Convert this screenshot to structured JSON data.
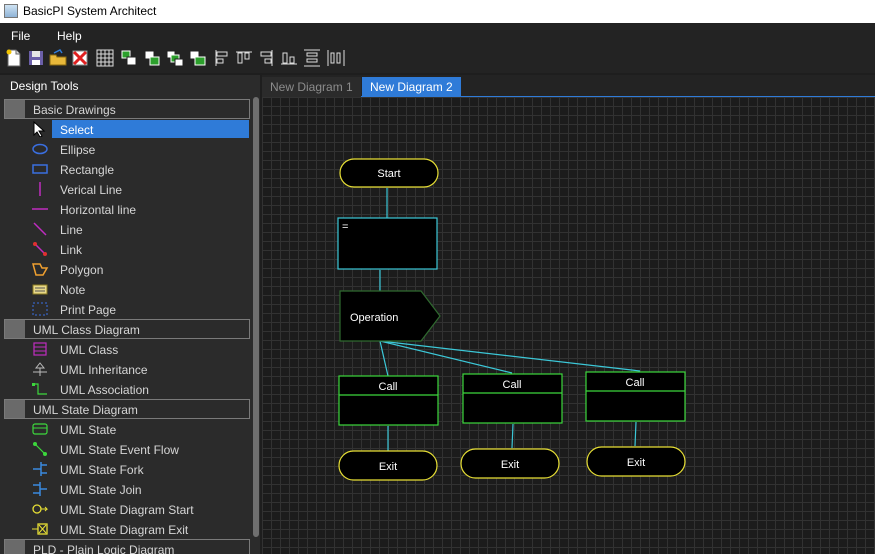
{
  "window": {
    "title": "BasicPI System Architect"
  },
  "menu": {
    "file": "File",
    "help": "Help"
  },
  "toolbar": {
    "icons": [
      "new-file-icon",
      "save-icon",
      "open-folder-icon",
      "delete-icon",
      "grid-icon",
      "group-icon",
      "ungroup-icon",
      "bring-front-icon",
      "send-back-icon",
      "align-left-icon",
      "align-top-icon",
      "align-right-icon",
      "align-bottom-icon",
      "distribute-vertical-icon",
      "distribute-horizontal-icon"
    ]
  },
  "panel": {
    "title": "Design Tools",
    "categories": [
      {
        "label": "Basic Drawings",
        "items": [
          {
            "label": "Select",
            "icon": "pointer-icon",
            "selected": true
          },
          {
            "label": "Ellipse",
            "icon": "ellipse-icon"
          },
          {
            "label": "Rectangle",
            "icon": "rectangle-icon"
          },
          {
            "label": "Verical Line",
            "icon": "vertical-line-icon"
          },
          {
            "label": "Horizontal line",
            "icon": "horizontal-line-icon"
          },
          {
            "label": "Line",
            "icon": "line-icon"
          },
          {
            "label": "Link",
            "icon": "link-icon"
          },
          {
            "label": "Polygon",
            "icon": "polygon-icon"
          },
          {
            "label": "Note",
            "icon": "note-icon"
          },
          {
            "label": "Print Page",
            "icon": "print-page-icon"
          }
        ]
      },
      {
        "label": "UML Class Diagram",
        "items": [
          {
            "label": "UML Class",
            "icon": "uml-class-icon"
          },
          {
            "label": "UML Inheritance",
            "icon": "uml-inheritance-icon"
          },
          {
            "label": "UML Association",
            "icon": "uml-association-icon"
          }
        ]
      },
      {
        "label": "UML State Diagram",
        "items": [
          {
            "label": "UML State",
            "icon": "uml-state-icon"
          },
          {
            "label": "UML State Event Flow",
            "icon": "state-event-flow-icon"
          },
          {
            "label": "UML State Fork",
            "icon": "state-fork-icon"
          },
          {
            "label": "UML State Join",
            "icon": "state-join-icon"
          },
          {
            "label": "UML State Diagram Start",
            "icon": "state-start-icon"
          },
          {
            "label": "UML State Diagram Exit",
            "icon": "state-exit-icon"
          }
        ]
      },
      {
        "label": "PLD - Plain Logic Diagram",
        "items": []
      }
    ]
  },
  "tabs": [
    {
      "label": "New Diagram 1",
      "active": false
    },
    {
      "label": "New Diagram 2",
      "active": true
    }
  ],
  "diagram": {
    "start": "Start",
    "assign": "=",
    "operation": "Operation",
    "calls": [
      "Call",
      "Call",
      "Call"
    ],
    "exits": [
      "Exit",
      "Exit",
      "Exit"
    ]
  },
  "colors": {
    "accent": "#2f7bd8",
    "terminal_border": "#e8e035",
    "assign_border": "#3cc8d8",
    "call_border": "#3cd83c",
    "connector": "#3cc8d8",
    "background": "#1c1c1c"
  }
}
